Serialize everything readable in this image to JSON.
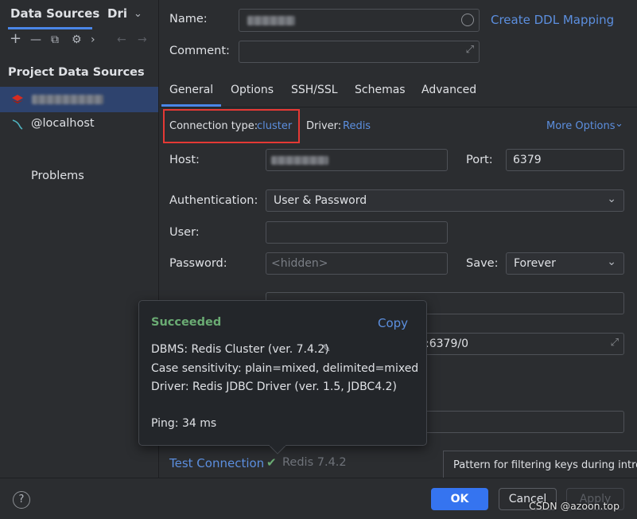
{
  "left_panel": {
    "tab_data_sources": "Data Sources",
    "tab_drivers": "Dri",
    "toolbar": {
      "add": "+",
      "remove": "—",
      "duplicate": "⧉",
      "settings": "⚙",
      "more": "›",
      "back": "←",
      "forward": "→"
    },
    "section_title": "Project Data Sources",
    "items": [
      {
        "label": ""
      },
      {
        "label": "@localhost"
      }
    ],
    "problems": "Problems"
  },
  "form": {
    "name_label": "Name:",
    "create_ddl": "Create DDL Mapping",
    "comment_label": "Comment:",
    "tabs": [
      "General",
      "Options",
      "SSH/SSL",
      "Schemas",
      "Advanced"
    ],
    "connection_type_label": "Connection type:",
    "connection_type_value": "cluster",
    "driver_label": "Driver:",
    "driver_value": "Redis",
    "more_options": "More Options",
    "host_label": "Host:",
    "port_label": "Port:",
    "port_value": "6379",
    "auth_label": "Authentication:",
    "auth_value": "User & Password",
    "user_label": "User:",
    "password_label": "Password:",
    "password_placeholder": "<hidden>",
    "save_label": "Save:",
    "save_value": "Forever",
    "url_fragment": ":6379/0",
    "test_connection": "Test Connection",
    "test_result": "Redis 7.4.2"
  },
  "popup": {
    "status": "Succeeded",
    "copy": "Copy",
    "dbms": "DBMS: Redis Cluster (ver. 7.4.2)",
    "case": "Case sensitivity: plain=mixed, delimited=mixed",
    "driver": "Driver: Redis JDBC Driver (ver. 1.5, JDBC4.2)",
    "ping": "Ping: 34 ms"
  },
  "tooltip": "Pattern for filtering keys during introsp",
  "footer": {
    "help": "?",
    "ok": "OK",
    "cancel": "Cancel",
    "apply": "Apply",
    "watermark": "CSDN @azoon.top"
  },
  "colors": {
    "accent": "#4a86e8",
    "link": "#5c8fdf",
    "success": "#6aab73",
    "highlight": "#e53935"
  }
}
